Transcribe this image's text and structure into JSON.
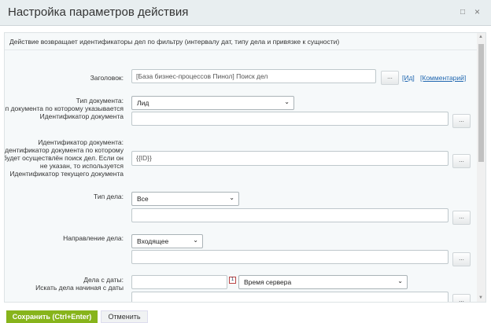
{
  "dialog": {
    "title": "Настройка параметров действия",
    "maximize_icon": "□",
    "close_icon": "×"
  },
  "description": "Действие возвращает идентификаторы дел по фильтру (интервалу дат, типу дела и привязке к сущности)",
  "fields": {
    "title": {
      "label": "Заголовок:",
      "value": "[База бизнес-процессов Пинол] Поиск дел",
      "link_id": "[Ид]",
      "link_comment": "[Комментарий]"
    },
    "doc_type": {
      "label": "Тип документа:\nТип документа по которому указывается Идентификатор документа",
      "value": "Лид"
    },
    "doc_id": {
      "label": "Идентификатор документа:\nИдентификатор документа по которому будет осуществлён поиск дел. Если он не указан, то используется Идентификатор текущего документа",
      "value": "{{ID}}"
    },
    "activity_type": {
      "label": "Тип дела:",
      "value": "Все"
    },
    "direction": {
      "label": "Направление дела:",
      "value": "Входящее"
    },
    "date_from": {
      "label": "Дела с даты:\nИскать дела начиная с даты",
      "value": "",
      "timezone": "Время сервера",
      "calendar_icon": "1"
    }
  },
  "buttons": {
    "more": "...",
    "save": "Сохранить (Ctrl+Enter)",
    "cancel": "Отменить"
  }
}
